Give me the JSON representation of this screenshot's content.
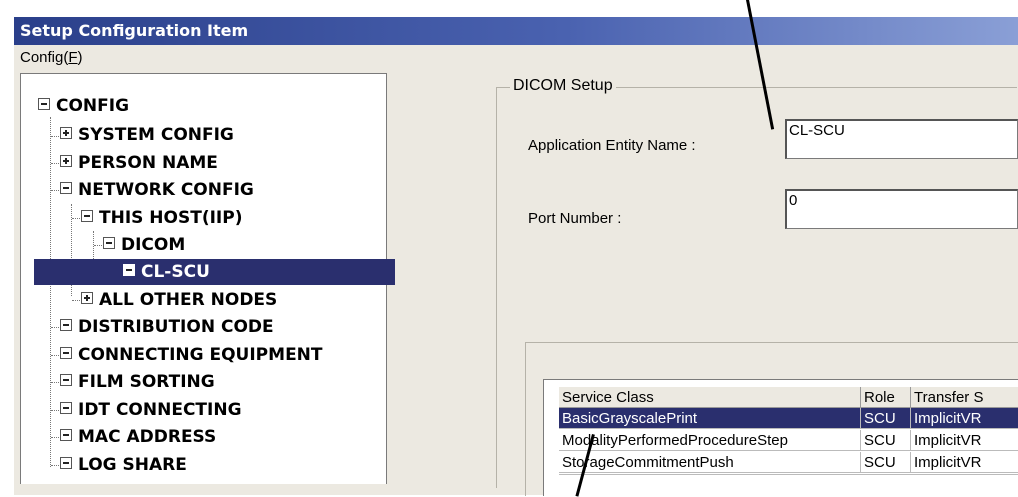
{
  "window": {
    "title": "Setup Configuration Item"
  },
  "menu": {
    "config_prefix": "Config(",
    "config_key": "F",
    "config_suffix": ")"
  },
  "tree": {
    "items": [
      {
        "label": "CONFIG"
      },
      {
        "label": "SYSTEM CONFIG"
      },
      {
        "label": "PERSON NAME"
      },
      {
        "label": "NETWORK CONFIG"
      },
      {
        "label": "THIS HOST(IIP)"
      },
      {
        "label": "DICOM"
      },
      {
        "label": "CL-SCU"
      },
      {
        "label": "ALL OTHER NODES"
      },
      {
        "label": "DISTRIBUTION CODE"
      },
      {
        "label": "CONNECTING EQUIPMENT"
      },
      {
        "label": "FILM SORTING"
      },
      {
        "label": "IDT CONNECTING"
      },
      {
        "label": "MAC ADDRESS"
      },
      {
        "label": "LOG SHARE"
      }
    ],
    "selected": "CL-SCU"
  },
  "dicom_setup": {
    "group_label": "DICOM Setup",
    "ae_name_label": "Application Entity Name :",
    "ae_name_value": "CL-SCU",
    "port_label": "Port Number :",
    "port_value": "0"
  },
  "service_table": {
    "headers": [
      "Service Class",
      "Role",
      "Transfer S"
    ],
    "rows": [
      [
        "BasicGrayscalePrint",
        "SCU",
        "ImplicitVR"
      ],
      [
        "ModalityPerformedProcedureStep",
        "SCU",
        "ImplicitVR"
      ],
      [
        "StorageCommitmentPush",
        "SCU",
        "ImplicitVR"
      ]
    ]
  },
  "colors": {
    "selection": "#2a2f6e",
    "title_bar": "#2a3f8a",
    "window_bg": "#ece9e1"
  }
}
